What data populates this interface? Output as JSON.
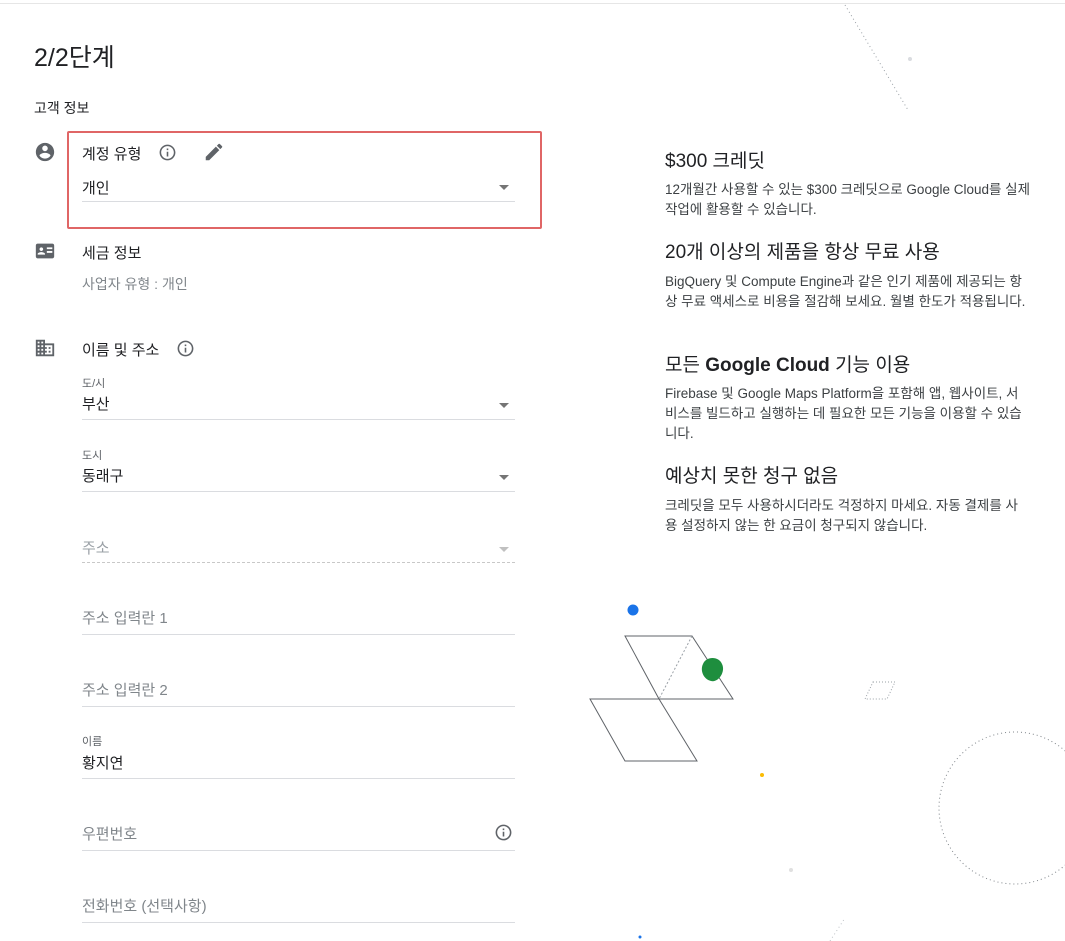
{
  "header": {
    "step": "2/2단계",
    "section_title": "고객 정보"
  },
  "account_type": {
    "label": "계정 유형",
    "value": "개인",
    "info_icon": "info-icon",
    "edit_icon": "pencil-icon",
    "row_icon": "account-circle-icon",
    "highlight_color": "#e06666"
  },
  "tax_info": {
    "label": "세금 정보",
    "subtext": "사업자 유형 : 개인",
    "row_icon": "id-card-icon"
  },
  "name_address": {
    "label": "이름 및 주소",
    "row_icon": "building-icon",
    "info_icon": "info-icon",
    "province": {
      "label": "도/시",
      "value": "부산"
    },
    "city": {
      "label": "도시",
      "value": "동래구"
    },
    "address_select": {
      "placeholder": "주소"
    },
    "address_line1": {
      "placeholder": "주소 입력란 1"
    },
    "address_line2": {
      "placeholder": "주소 입력란 2"
    },
    "name": {
      "label": "이름",
      "value": "황지연"
    },
    "postal_code": {
      "placeholder": "우편번호"
    },
    "phone": {
      "placeholder": "전화번호 (선택사항)"
    }
  },
  "benefits": [
    {
      "title": "$300 크레딧",
      "description": "12개월간 사용할 수 있는 $300 크레딧으로 Google Cloud를 실제 작업에 활용할 수 있습니다."
    },
    {
      "title": "20개 이상의 제품을 항상 무료 사용",
      "description": "BigQuery 및 Compute Engine과 같은 인기 제품에 제공되는 항상 무료 액세스로 비용을 절감해 보세요. 월별 한도가 적용됩니다."
    },
    {
      "title_prefix": "모든 ",
      "title_brand": "Google Cloud",
      "title_suffix": " 기능 이용",
      "description": "Firebase 및 Google Maps Platform을 포함해 앱, 웹사이트, 서비스를 빌드하고 실행하는 데 필요한 모든 기능을 이용할 수 있습니다."
    },
    {
      "title": "예상치 못한 청구 없음",
      "description": "크레딧을 모두 사용하시더라도 걱정하지 마세요. 자동 결제를 사용 설정하지 않는 한 요금이 청구되지 않습니다."
    }
  ],
  "colors": {
    "blue_dot": "#1a73e8",
    "green_dot": "#1e8e3e",
    "yellow_dot": "#fbbc04"
  }
}
